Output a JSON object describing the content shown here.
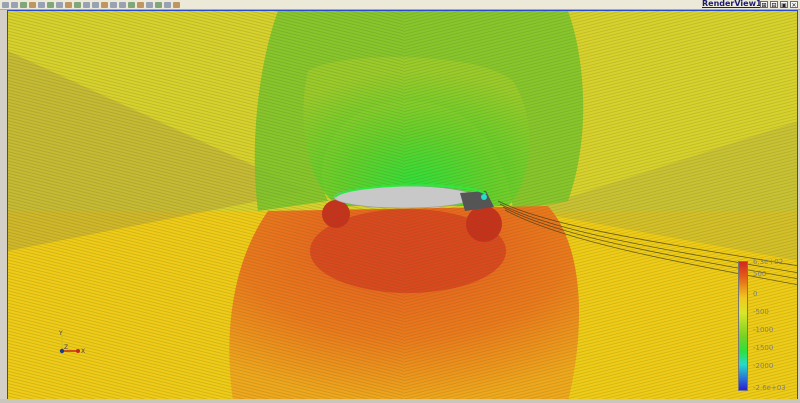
{
  "toolbar": {
    "icons": [
      "reset-camera-icon",
      "zoom-to-data-icon",
      "rotate-icon",
      "pan-icon",
      "select-cells-icon",
      "select-points-icon",
      "frustum-select-icon",
      "pick-icon",
      "camera-undo-icon",
      "camera-redo-icon",
      "interact-icon",
      "select-block-icon",
      "hover-points-icon",
      "hover-cells-icon",
      "zoom-box-icon",
      "ruler-icon",
      "center-axis-icon",
      "orientation-icon",
      "split-h-icon",
      "split-v-icon"
    ]
  },
  "view": {
    "title": "RenderView1",
    "buttons": [
      "⊞",
      "⊟",
      "▣",
      "✕"
    ]
  },
  "legend": {
    "labels": [
      "6.3e+02",
      "500",
      "0",
      "-500",
      "-1000",
      "-1500",
      "-2000",
      "-2.6e+03"
    ],
    "colors": {
      "max": "#d2281e",
      "min": "#2c1ed2"
    }
  },
  "axes": {
    "y": "Y",
    "x": "X",
    "z": "Z"
  },
  "colors": {
    "background": "#e8cf32",
    "highPressure": "#e0621f",
    "lowPressure": "#22e23c",
    "body": "#c8c8c8"
  }
}
